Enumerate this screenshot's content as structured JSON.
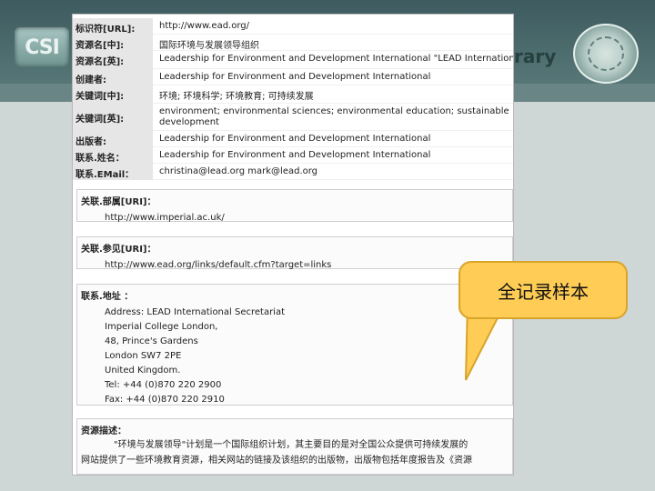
{
  "banner": {
    "logo_left": "CSI",
    "logo_right_text": "rary"
  },
  "record": {
    "fields": [
      {
        "label": "标识符[URL]:",
        "value": "http://www.ead.org/"
      },
      {
        "label": "资源名[中]:",
        "value": "国际环境与发展领导组织"
      },
      {
        "label": "资源名[英]:",
        "value": "Leadership for Environment and Development International \"LEAD International\""
      },
      {
        "label": "创建者:",
        "value": "Leadership for Environment and Development International"
      },
      {
        "label": "关键词[中]:",
        "value": "环境; 环境科学; 环境教育; 可持续发展"
      },
      {
        "label": "关键词[英]:",
        "value": "environment; environmental sciences; environmental education; sustainable development"
      },
      {
        "label": "出版者:",
        "value": "Leadership for Environment and Development International"
      },
      {
        "label": "联系.姓名：",
        "value": "Leadership for Environment and Development International"
      },
      {
        "label": "联系.EMail：",
        "value": "christina@lead.org mark@lead.org"
      }
    ],
    "related_part": {
      "label": "关联.部属[URI]：",
      "value": "http://www.imperial.ac.uk/"
    },
    "related_ref": {
      "label": "关联.参见[URI]：",
      "value": "http://www.ead.org/links/default.cfm?target=links"
    },
    "address": {
      "label": "联系.地址 ：",
      "lines": [
        "Address: LEAD International Secretariat",
        "Imperial College London,",
        "48, Prince's Gardens",
        "London SW7 2PE",
        "United Kingdom.",
        "Tel: +44 (0)870 220 2900",
        "Fax: +44 (0)870 220 2910"
      ]
    },
    "description": {
      "label": "资源描述：",
      "text_line1": "\"环境与发展领导\"计划是一个国际组织计划，其主要目的是对全国公众提供可持续发展的",
      "text_line2": "网站提供了一些环境教育资源，相关网站的链接及该组织的出版物，出版物包括年度报告及《资源"
    }
  },
  "callout": {
    "text": "全记录样本"
  }
}
